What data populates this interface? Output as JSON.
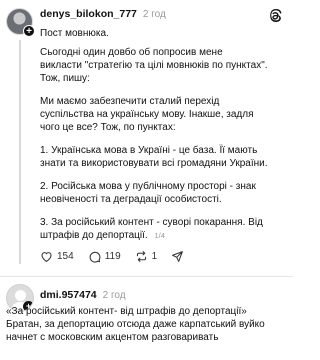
{
  "post": {
    "username": "denys_bilokon_777",
    "time": "2 год",
    "lines": {
      "l1": "Пост мовнюка.",
      "l2": "Сьогодні один довбо  об попросив мене",
      "l3": "викласти \"стратегію та цілі мовнюків по пунктах\".",
      "l4": "Тож, пишу:",
      "l5": "Ми маємо забезпечити сталий перехід",
      "l6": "суспільства на українську мову. Інакше, задля",
      "l7": "чого це все? Тож, по пунктах:",
      "l8": "1. Українська мова в Україні - це база. Її мають",
      "l9": "знати та використовувати всі громадяни України.",
      "l10": "2. Російська мова у публічному просторі - знак",
      "l11": "неовіченості та деградації особистості.",
      "l12": "3. За російський контент - суворі покарання. Від",
      "l13": "штрафів до депортації.",
      "page_indicator": "1/4"
    },
    "actions": {
      "likes": "154",
      "comments": "119",
      "reposts": "1"
    }
  },
  "reply": {
    "username": "dmi.957474",
    "time": "2 год",
    "lines": {
      "l1": "«За російський контент- від штрафів до депортації»",
      "l2": "Братан, за депортацию отсюда даже карпатський вуйко",
      "l3": "начнет с московским акцентом разговаривать"
    }
  },
  "icons": {
    "logo": "threads-logo-icon",
    "like": "heart-icon",
    "comment": "comment-bubble-icon",
    "repost": "repost-arrows-icon"
  }
}
